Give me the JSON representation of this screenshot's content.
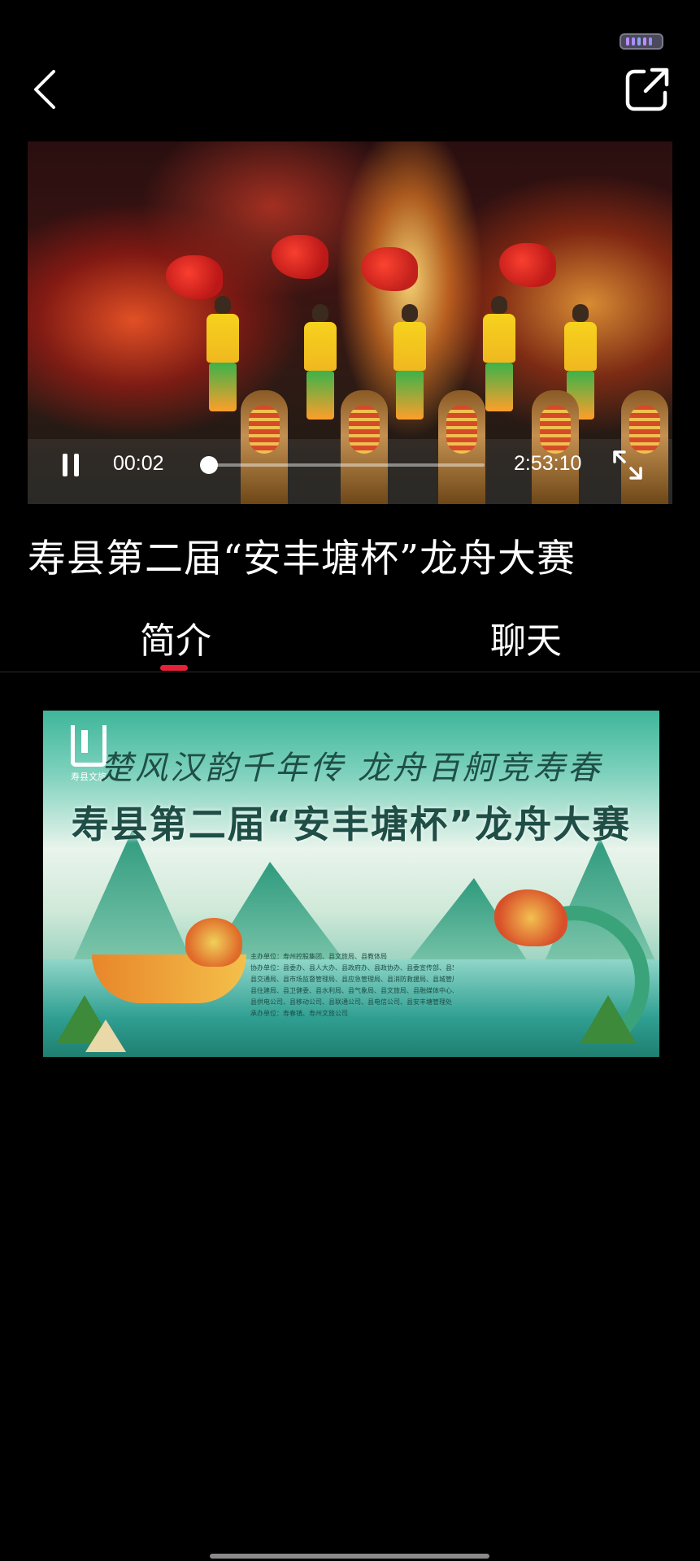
{
  "status_bar": {
    "indicator": "battery-pill-icon"
  },
  "top_bar": {
    "back_icon": "chevron-left-icon",
    "share_icon": "share-external-icon"
  },
  "video": {
    "current_time": "00:02",
    "duration": "2:53:10",
    "progress_fraction": 0.0002,
    "state": "playing",
    "pause_icon": "pause-icon",
    "fullscreen_icon": "fullscreen-expand-icon"
  },
  "title": "寿县第二届“安丰塘杯”龙舟大赛",
  "tabs": [
    {
      "label": "简介",
      "active": true
    },
    {
      "label": "聊天",
      "active": false
    }
  ],
  "colors": {
    "accent": "#e6223a",
    "background": "#000000"
  },
  "poster": {
    "logo_text": "寿县文旅",
    "slogan": "楚风汉韵千年传 龙舟百舸竞寿春",
    "title": "寿县第二届“安丰塘杯”龙舟大赛",
    "credits": [
      "主办单位：寿州控股集团、县文旅局、县教体局",
      "协办单位：县委办、县人大办、县政府办、县政协办、县委宣传部、县5A办、县公安局、",
      "县交通局、县市场监督管理局、县应急管理局、县消防救援局、县城管局、",
      "县住建局、县卫健委、县水利局、县气象局、县文旅局、县融媒体中心、",
      "县供电公司、县移动公司、县联通公司、县电信公司、县安丰塘管理处",
      "承办单位：寿春镇、寿州文旅公司"
    ]
  }
}
